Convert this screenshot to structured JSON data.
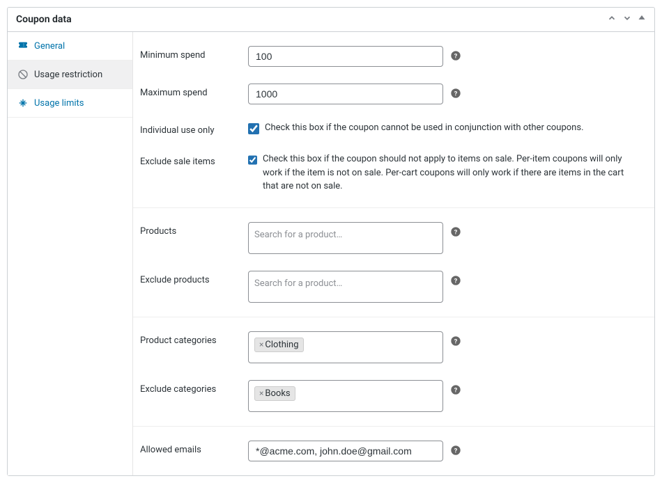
{
  "panel": {
    "title": "Coupon data"
  },
  "sidebar": {
    "items": [
      {
        "label": "General"
      },
      {
        "label": "Usage restriction"
      },
      {
        "label": "Usage limits"
      }
    ]
  },
  "fields": {
    "min_spend": {
      "label": "Minimum spend",
      "value": "100"
    },
    "max_spend": {
      "label": "Maximum spend",
      "value": "1000"
    },
    "individual_use": {
      "label": "Individual use only",
      "desc": "Check this box if the coupon cannot be used in conjunction with other coupons."
    },
    "exclude_sale": {
      "label": "Exclude sale items",
      "desc": "Check this box if the coupon should not apply to items on sale. Per-item coupons will only work if the item is not on sale. Per-cart coupons will only work if there are items in the cart that are not on sale."
    },
    "products": {
      "label": "Products",
      "placeholder": "Search for a product…"
    },
    "exclude_products": {
      "label": "Exclude products",
      "placeholder": "Search for a product…"
    },
    "product_categories": {
      "label": "Product categories",
      "tags": [
        "Clothing"
      ]
    },
    "exclude_categories": {
      "label": "Exclude categories",
      "tags": [
        "Books"
      ]
    },
    "allowed_emails": {
      "label": "Allowed emails",
      "value": "*@acme.com, john.doe@gmail.com"
    }
  }
}
